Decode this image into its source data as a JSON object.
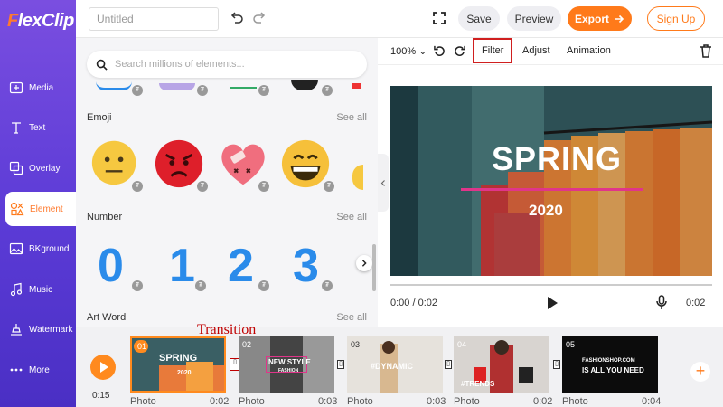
{
  "app": {
    "logo_prefix": "F",
    "logo_rest": "lexClip"
  },
  "sidebar": {
    "items": [
      {
        "label": "Media",
        "icon": "media-icon"
      },
      {
        "label": "Text",
        "icon": "text-icon"
      },
      {
        "label": "Overlay",
        "icon": "overlay-icon"
      },
      {
        "label": "Element",
        "icon": "element-icon",
        "active": true
      },
      {
        "label": "BKground",
        "icon": "background-icon"
      },
      {
        "label": "Music",
        "icon": "music-icon"
      },
      {
        "label": "Watermark",
        "icon": "watermark-icon"
      },
      {
        "label": "More",
        "icon": "more-icon"
      }
    ]
  },
  "topbar": {
    "title_placeholder": "Untitled",
    "save_label": "Save",
    "preview_label": "Preview",
    "export_label": "Export",
    "signup_label": "Sign Up"
  },
  "panel": {
    "search_placeholder": "Search millions of elements...",
    "sections": [
      {
        "title": "Emoji",
        "see_all": "See all"
      },
      {
        "title": "Number",
        "see_all": "See all"
      },
      {
        "title": "Art Word",
        "see_all": "See all"
      }
    ],
    "numbers": [
      "0",
      "1",
      "2",
      "3"
    ]
  },
  "editor_toolbar": {
    "zoom": "100%",
    "filter_label": "Filter",
    "adjust_label": "Adjust",
    "animation_label": "Animation"
  },
  "preview": {
    "title": "SPRING",
    "year": "2020",
    "current_time": "0:00 / 0:02",
    "duration": "0:02"
  },
  "timeline": {
    "elapsed": "0:15",
    "transition_label": "Transition",
    "clips": [
      {
        "num": "01",
        "caption": "Photo",
        "duration": "0:02",
        "text": "SPRING",
        "subtext": "2020"
      },
      {
        "num": "02",
        "caption": "Photo",
        "duration": "0:03",
        "text": "NEW STYLE",
        "subtext": "FASHION"
      },
      {
        "num": "03",
        "caption": "Photo",
        "duration": "0:03",
        "text": "#DYNAMIC",
        "subtext": ""
      },
      {
        "num": "04",
        "caption": "Photo",
        "duration": "0:02",
        "text": "#TRENDS",
        "subtext": ""
      },
      {
        "num": "05",
        "caption": "Photo",
        "duration": "0:04",
        "text": "FASHIONSHOP.COM",
        "subtext": "IS ALL YOU NEED"
      }
    ]
  },
  "colors": {
    "accent": "#ff7a1a",
    "sidebar": "#5b3bd6",
    "highlight_box": "#d01f1f",
    "numbers": "#2a8bea"
  }
}
